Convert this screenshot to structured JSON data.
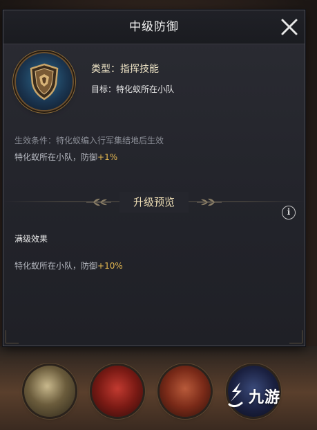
{
  "dialog": {
    "title": "中级防御",
    "skill": {
      "type_label": "类型：指挥技能",
      "target_label": "目标：特化蚁所在小队"
    },
    "condition": "生效条件：特化蚁编入行军集结地后生效",
    "effect": {
      "prefix": "特化蚁所在小队，防御",
      "value": "+1%"
    },
    "upgrade_preview_title": "升级预览",
    "max_level_label": "满级效果",
    "max_effect": {
      "prefix": "特化蚁所在小队，防御",
      "value": "+10%"
    }
  },
  "watermark": {
    "text": "九游"
  },
  "colors": {
    "accent_gold": "#e5b850",
    "panel_bg": "#24252c",
    "text_muted": "#8c8f98"
  },
  "icons": [
    "close-icon",
    "shield-skill-icon",
    "info-icon",
    "laurel-ornament-icon",
    "jiuyou-logo-icon"
  ]
}
